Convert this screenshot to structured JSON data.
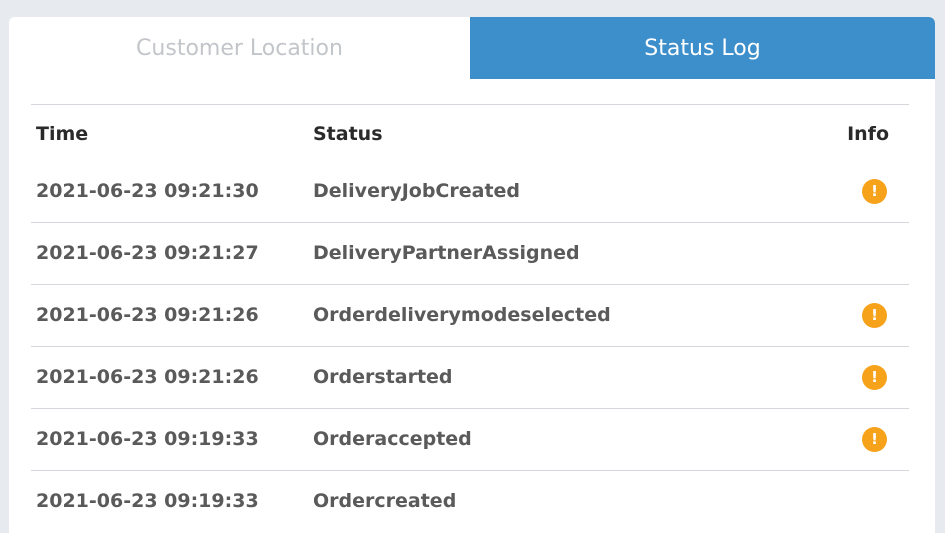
{
  "tabs": {
    "customer_location": "Customer Location",
    "status_log": "Status Log"
  },
  "table": {
    "headers": {
      "time": "Time",
      "status": "Status",
      "info": "Info"
    },
    "rows": [
      {
        "time": "2021-06-23 09:21:30",
        "status": "DeliveryJobCreated",
        "has_info": true,
        "info_icon": "!"
      },
      {
        "time": "2021-06-23 09:21:27",
        "status": "DeliveryPartnerAssigned",
        "has_info": false
      },
      {
        "time": "2021-06-23 09:21:26",
        "status": "Orderdeliverymodeselected",
        "has_info": true,
        "info_icon": "!"
      },
      {
        "time": "2021-06-23 09:21:26",
        "status": "Orderstarted",
        "has_info": true,
        "info_icon": "!"
      },
      {
        "time": "2021-06-23 09:19:33",
        "status": "Orderaccepted",
        "has_info": true,
        "info_icon": "!"
      },
      {
        "time": "2021-06-23 09:19:33",
        "status": "Ordercreated",
        "has_info": false
      }
    ]
  },
  "colors": {
    "active_tab": "#3d8fcb",
    "info_icon": "#f7a21b",
    "inactive_tab_text": "#c2c5c9"
  }
}
